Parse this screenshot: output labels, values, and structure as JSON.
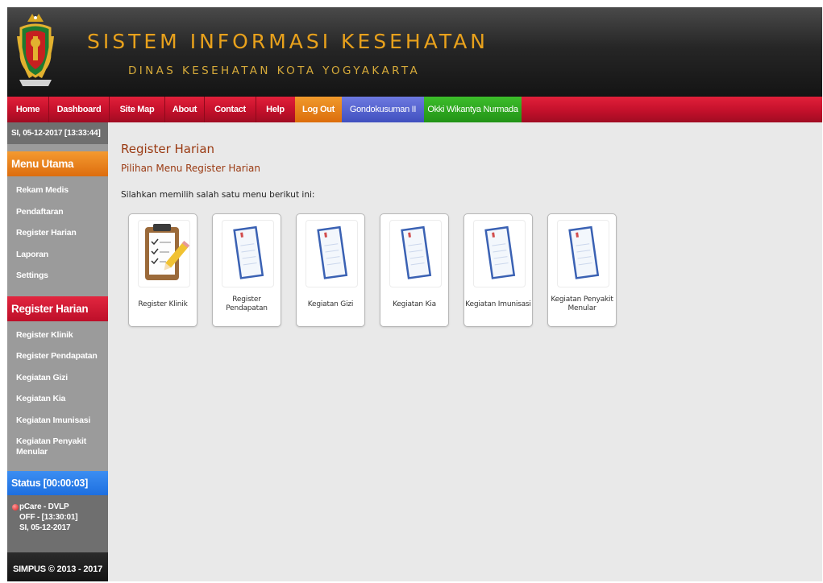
{
  "header": {
    "title": "SISTEM INFORMASI KESEHATAN",
    "subtitle": "DINAS KESEHATAN KOTA YOGYAKARTA"
  },
  "nav": {
    "items": [
      "Home",
      "Dashboard",
      "Site Map",
      "About",
      "Contact",
      "Help",
      "Log Out"
    ],
    "unit": "Gondokusuman II",
    "user": "Okki Wikantya Nurmada"
  },
  "sidebar": {
    "datetime": "SI, 05-12-2017 [13:33:44]",
    "menu_utama_title": "Menu Utama",
    "menu_utama": [
      "Rekam Medis",
      "Pendaftaran",
      "Register Harian",
      "Laporan",
      "Settings"
    ],
    "register_title": "Register Harian",
    "register_items": [
      "Register Klinik",
      "Register Pendapatan",
      "Kegiatan Gizi",
      "Kegiatan Kia",
      "Kegiatan Imunisasi",
      "Kegiatan Penyakit Menular"
    ],
    "status_title": "Status  [00:00:03]",
    "status_lines": [
      "pCare - DVLP",
      "OFF - [13:30:01]",
      "SI, 05-12-2017"
    ],
    "footer": "SIMPUS © 2013 - 2017"
  },
  "main": {
    "title": "Register Harian",
    "subtitle": "Pilihan Menu Register Harian",
    "instruction": "Silahkan memilih salah satu menu berikut ini:",
    "cards": [
      {
        "label": "Register Klinik",
        "icon": "clipboard-icon"
      },
      {
        "label": "Register Pendapatan",
        "icon": "document-icon"
      },
      {
        "label": "Kegiatan Gizi",
        "icon": "document-icon"
      },
      {
        "label": "Kegiatan Kia",
        "icon": "document-icon"
      },
      {
        "label": "Kegiatan Imunisasi",
        "icon": "document-icon"
      },
      {
        "label": "Kegiatan Penyakit Menular",
        "icon": "document-icon"
      }
    ]
  },
  "colors": {
    "nav_red": "#c3102b",
    "orange": "#f08c1e",
    "blue": "#2d7ff0",
    "green": "#2ca81f",
    "title_gold": "#e8a11c",
    "heading_brown": "#9a3a12"
  }
}
